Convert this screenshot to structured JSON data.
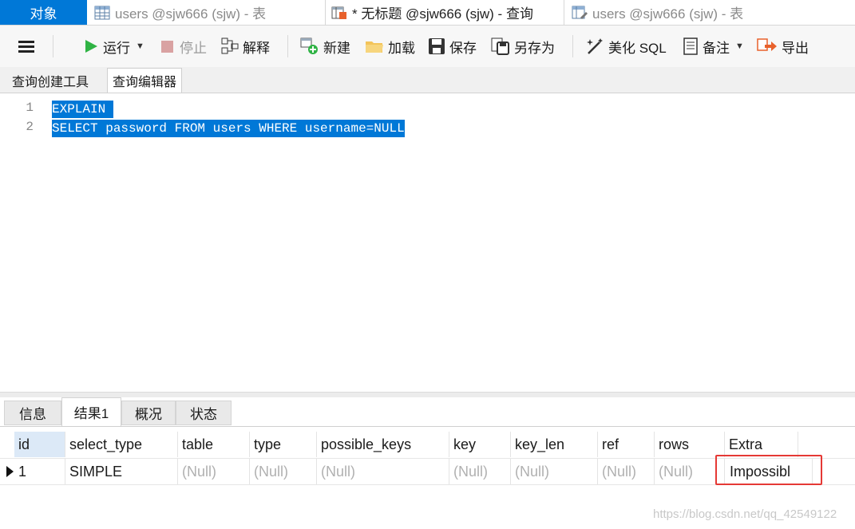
{
  "doc_tabs": {
    "objects": "对象",
    "tab1": "users @sjw666 (sjw) - 表",
    "tab2": "* 无标题 @sjw666 (sjw) - 查询",
    "tab3": "users @sjw666 (sjw) - 表"
  },
  "toolbar": {
    "run": "运行",
    "stop": "停止",
    "explain": "解释",
    "new": "新建",
    "load": "加载",
    "save": "保存",
    "save_as": "另存为",
    "beautify": "美化 SQL",
    "memo": "备注",
    "export": "导出"
  },
  "sub_tabs": {
    "builder": "查询创建工具",
    "editor": "查询编辑器"
  },
  "editor": {
    "lines": [
      {
        "num": "1",
        "text": "EXPLAIN "
      },
      {
        "num": "2",
        "text": "SELECT password FROM users WHERE username=NULL"
      }
    ]
  },
  "result_tabs": [
    "信息",
    "结果1",
    "概况",
    "状态"
  ],
  "grid": {
    "columns": [
      "id",
      "select_type",
      "table",
      "type",
      "possible_keys",
      "key",
      "key_len",
      "ref",
      "rows",
      "Extra"
    ],
    "rows": [
      [
        "1",
        "SIMPLE",
        "(Null)",
        "(Null)",
        "(Null)",
        "(Null)",
        "(Null)",
        "(Null)",
        "(Null)",
        "Impossibl"
      ]
    ]
  },
  "watermark": "https://blog.csdn.net/qq_42549122",
  "colors": {
    "accent": "#0078d7",
    "highlight": "#e53935",
    "null_text": "#b0b0b0"
  }
}
